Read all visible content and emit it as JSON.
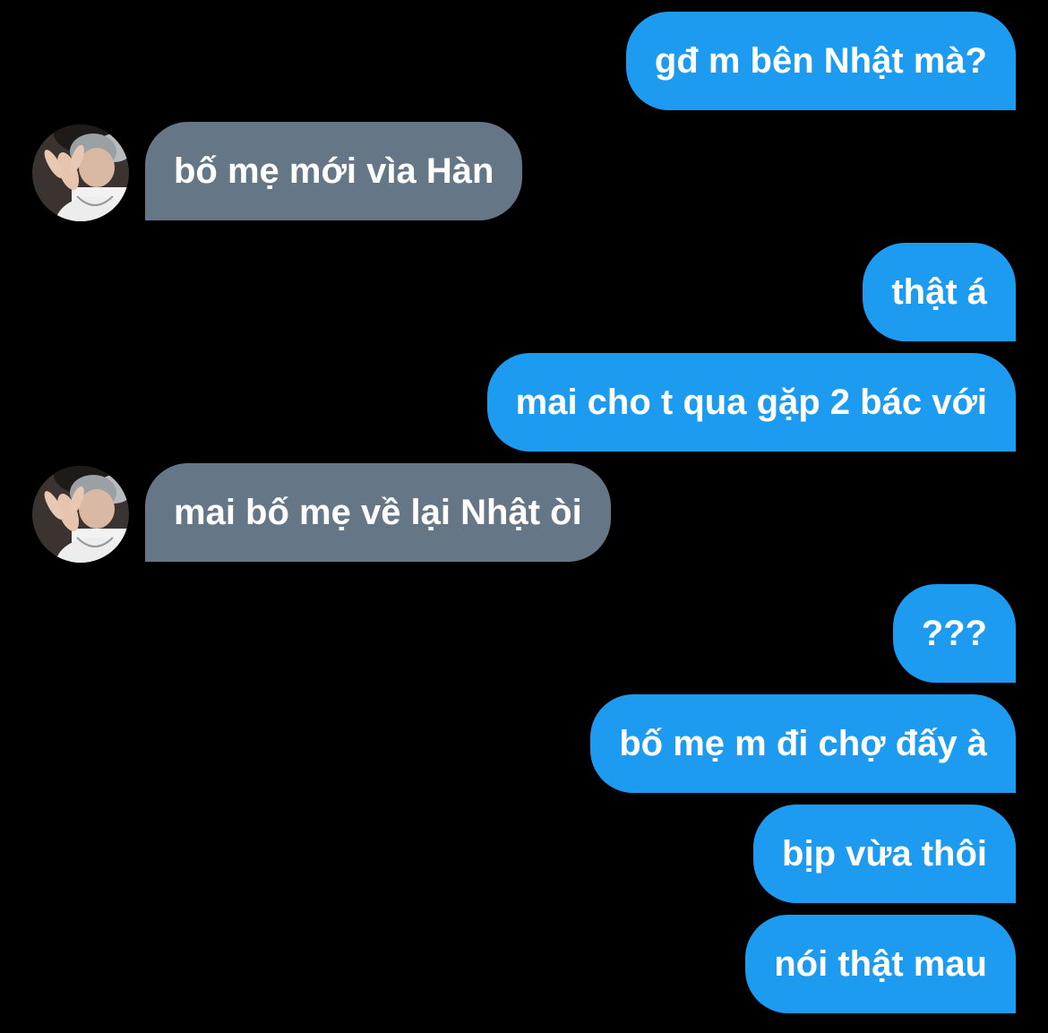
{
  "conversation": {
    "colors": {
      "background": "#000000",
      "sent_bubble": "#1d9bf0",
      "received_bubble": "#657786",
      "text": "#ffffff"
    },
    "messages": [
      {
        "side": "sent",
        "text": "gđ m bên Nhật mà?"
      },
      {
        "side": "received",
        "text": "bố mẹ mới vìa Hàn"
      },
      {
        "side": "sent",
        "text": "thật á"
      },
      {
        "side": "sent",
        "text": "mai cho t qua gặp 2 bác với"
      },
      {
        "side": "received",
        "text": "mai bố mẹ về lại Nhật òi"
      },
      {
        "side": "sent",
        "text": "???"
      },
      {
        "side": "sent",
        "text": "bố mẹ m đi chợ đấy à"
      },
      {
        "side": "sent",
        "text": "bịp vừa thôi"
      },
      {
        "side": "sent",
        "text": "nói thật mau"
      }
    ],
    "avatar_icon": "user-photo-avatar"
  }
}
